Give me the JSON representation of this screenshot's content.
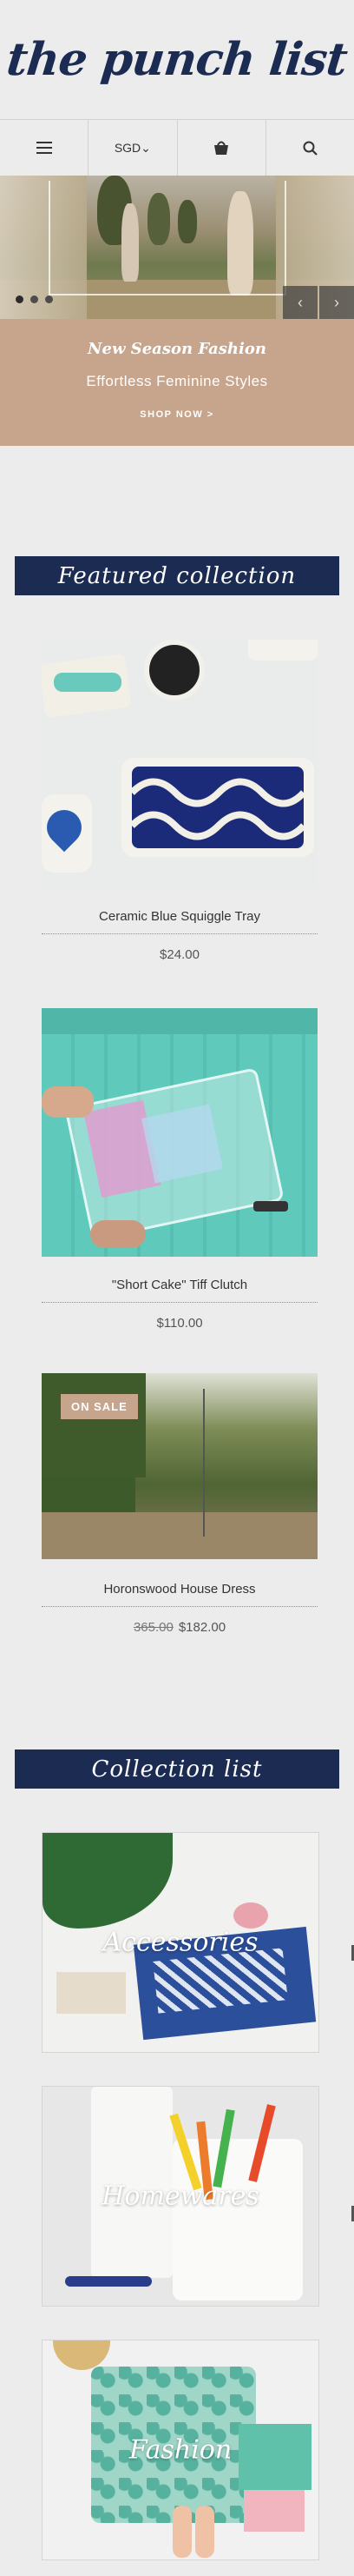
{
  "header": {
    "logo_text": "the punch list"
  },
  "nav": {
    "menu_icon": "hamburger-icon",
    "currency": "SGD",
    "cart_icon": "shopping-bag-icon",
    "search_icon": "search-icon"
  },
  "slideshow": {
    "dots": 3,
    "active_dot": 1,
    "prev_icon": "chevron-left-icon",
    "next_icon": "chevron-right-icon"
  },
  "promo": {
    "title": "New Season Fashion",
    "subtitle": "Effortless Feminine Styles",
    "cta": "SHOP NOW >"
  },
  "featured": {
    "title": "Featured collection",
    "products": [
      {
        "name": "Ceramic Blue Squiggle Tray",
        "price": "$24.00",
        "compare_price": "",
        "badge": ""
      },
      {
        "name": "\"Short Cake\" Tiff Clutch",
        "price": "$110.00",
        "compare_price": "",
        "badge": ""
      },
      {
        "name": "Horonswood House Dress",
        "price": "$182.00",
        "compare_price": "365.00",
        "badge": "ON SALE"
      }
    ]
  },
  "collections": {
    "title": "Collection list",
    "items": [
      {
        "label": "Accessories"
      },
      {
        "label": "Homewares"
      },
      {
        "label": "Fashion"
      }
    ]
  },
  "colors": {
    "navy": "#1b2b52",
    "tan": "#c7a58c",
    "background": "#ececec"
  }
}
